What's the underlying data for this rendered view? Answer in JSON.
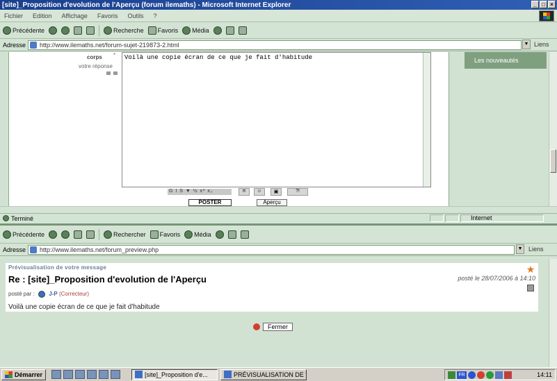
{
  "window1": {
    "title": "[site]_Proposition d'evolution de l'Aperçu (forum ilemaths) - Microsoft Internet Explorer",
    "menu": [
      "Fichier",
      "Edition",
      "Affichage",
      "Favoris",
      "Outils",
      "?"
    ],
    "toolbar": {
      "back": "Précédente",
      "search": "Recherche",
      "favorites": "Favoris",
      "media": "Média"
    },
    "address_label": "Adresse",
    "address_value": "http://www.ilemaths.net/forum-sujet-219873-2.html",
    "go_label": "Liens",
    "form": {
      "body_label": "corps",
      "required_mark": "*",
      "reply_label": "votre réponse",
      "textarea_value": "Voilà une copie écran de ce que je fait d'habitude",
      "format_buttons": "G I S ▼ ½ x² x₂",
      "post_button": "POSTER",
      "preview_button": "Aperçu"
    },
    "sidebar_link": "Les nouveautés",
    "status": "Terminé",
    "zone": "Internet"
  },
  "window2": {
    "toolbar": {
      "back": "Précédente",
      "search": "Rechercher",
      "favorites": "Favoris",
      "media": "Média"
    },
    "address_label": "Adresse",
    "address_value": "http://www.ilemaths.net/forum_preview.php",
    "go_label": "Liens",
    "preview_heading": "Prévisualisation de votre message",
    "message_title": "Re : [site]_Proposition d'evolution de l'Aperçu",
    "post_date": "posté le 28/07/2006 à 14:10",
    "posted_by_label": "posté par :",
    "author": "J-P",
    "role": "(Correcteur)",
    "body": "Voilà une copie écran de ce que je fait d'habitude",
    "close_button": "Fermer"
  },
  "taskbar": {
    "start": "Démarrer",
    "tasks": [
      "[site]_Proposition d'e...",
      "PRÉVISUALISATION DE V..."
    ],
    "tray_lang": "FR",
    "clock": "14:11"
  }
}
